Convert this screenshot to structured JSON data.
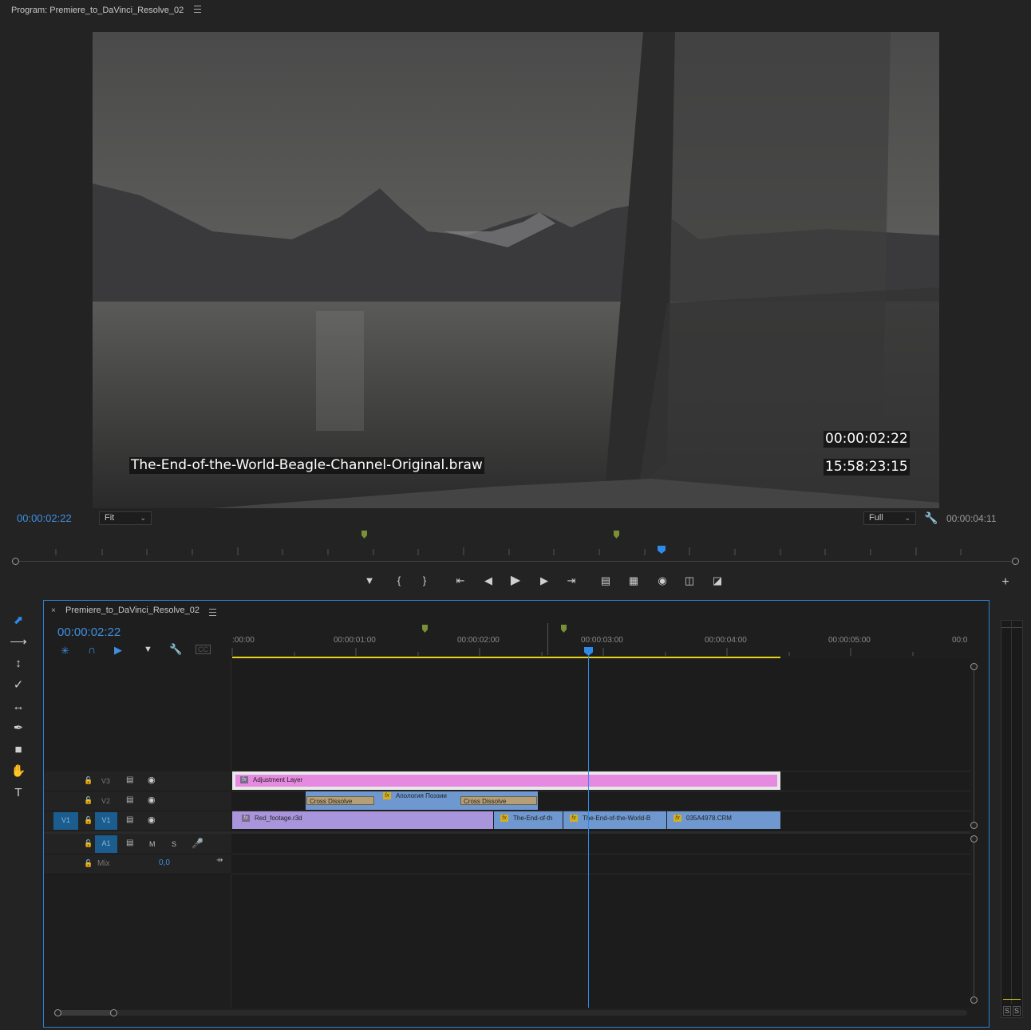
{
  "program": {
    "title": "Program: Premiere_to_DaVinci_Resolve_02",
    "clip_name_overlay": "The-End-of-the-World-Beagle-Channel-Original.braw",
    "overlay_tc": "00:00:02:22",
    "overlay_source_tc": "15:58:23:15",
    "current_tc": "00:00:02:22",
    "zoom": "Fit",
    "resolution": "Full",
    "duration_tc": "00:00:04:11"
  },
  "timeline": {
    "sequence_name": "Premiere_to_DaVinci_Resolve_02",
    "current_tc": "00:00:02:22",
    "ruler_labels": [
      ":00:00",
      "00:00:01:00",
      "00:00:02:00",
      "00:00:03:00",
      "00:00:04:00",
      "00:00:05:00",
      "00:0"
    ],
    "tracks": {
      "v3": "V3",
      "v2": "V2",
      "v1_src": "V1",
      "v1": "V1",
      "a1": "A1",
      "mix": "Mix",
      "mix_value": "0,0",
      "m": "M",
      "s": "S"
    },
    "clips": {
      "adjustment": "Adjustment Layer",
      "cross1": "Cross Dissolve",
      "apologia": "Апология Поэзии",
      "cross2": "Cross Dissolve",
      "red": "Red_footage.r3d",
      "end1": "The-End-of-th",
      "end2": "The-End-of-the-World-B",
      "crm": "035A4978.CRM"
    }
  },
  "meter": {
    "s1": "S",
    "s2": "S"
  },
  "colors": {
    "accent": "#2d8ceb",
    "adjustment": "#e58ae0",
    "v1_clip": "#a895db",
    "blue_clip": "#6e98cf",
    "marker": "#7a8f36",
    "work_area": "#e6d21a"
  }
}
